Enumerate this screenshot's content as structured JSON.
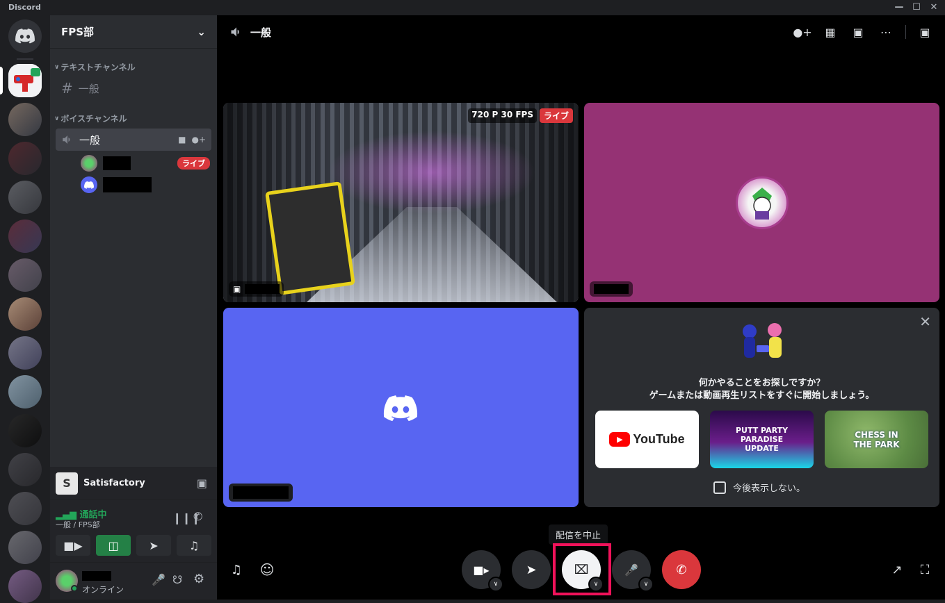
{
  "titlebar": {
    "app_name": "Discord"
  },
  "guild": {
    "name": "FPS部",
    "categories": {
      "text": "テキストチャンネル",
      "voice": "ボイスチャンネル"
    },
    "text_channel": "一般",
    "voice_channel": "一般",
    "live_label": "ライブ"
  },
  "activity": {
    "game": "Satisfactory"
  },
  "voice_panel": {
    "status": "通話中",
    "channel": "一般 / FPS部"
  },
  "user": {
    "status": "オンライン"
  },
  "main": {
    "channel_title": "一般"
  },
  "stream": {
    "quality": "720 P 30 FPS",
    "live": "ライブ"
  },
  "activity_card": {
    "question": "何かやることをお探しですか？",
    "subtitle": "ゲームまたは動画再生リストをすぐに開始しましょう。",
    "cards": [
      "YouTube",
      "PUTT PARTY PARADISE UPDATE",
      "CHESS IN THE PARK"
    ],
    "dont_show": "今後表示しない。"
  },
  "tooltip": "配信を中止",
  "colors": {
    "accent": "#5865f2",
    "live": "#da373c",
    "highlight": "#f0125a",
    "green": "#23a559"
  }
}
